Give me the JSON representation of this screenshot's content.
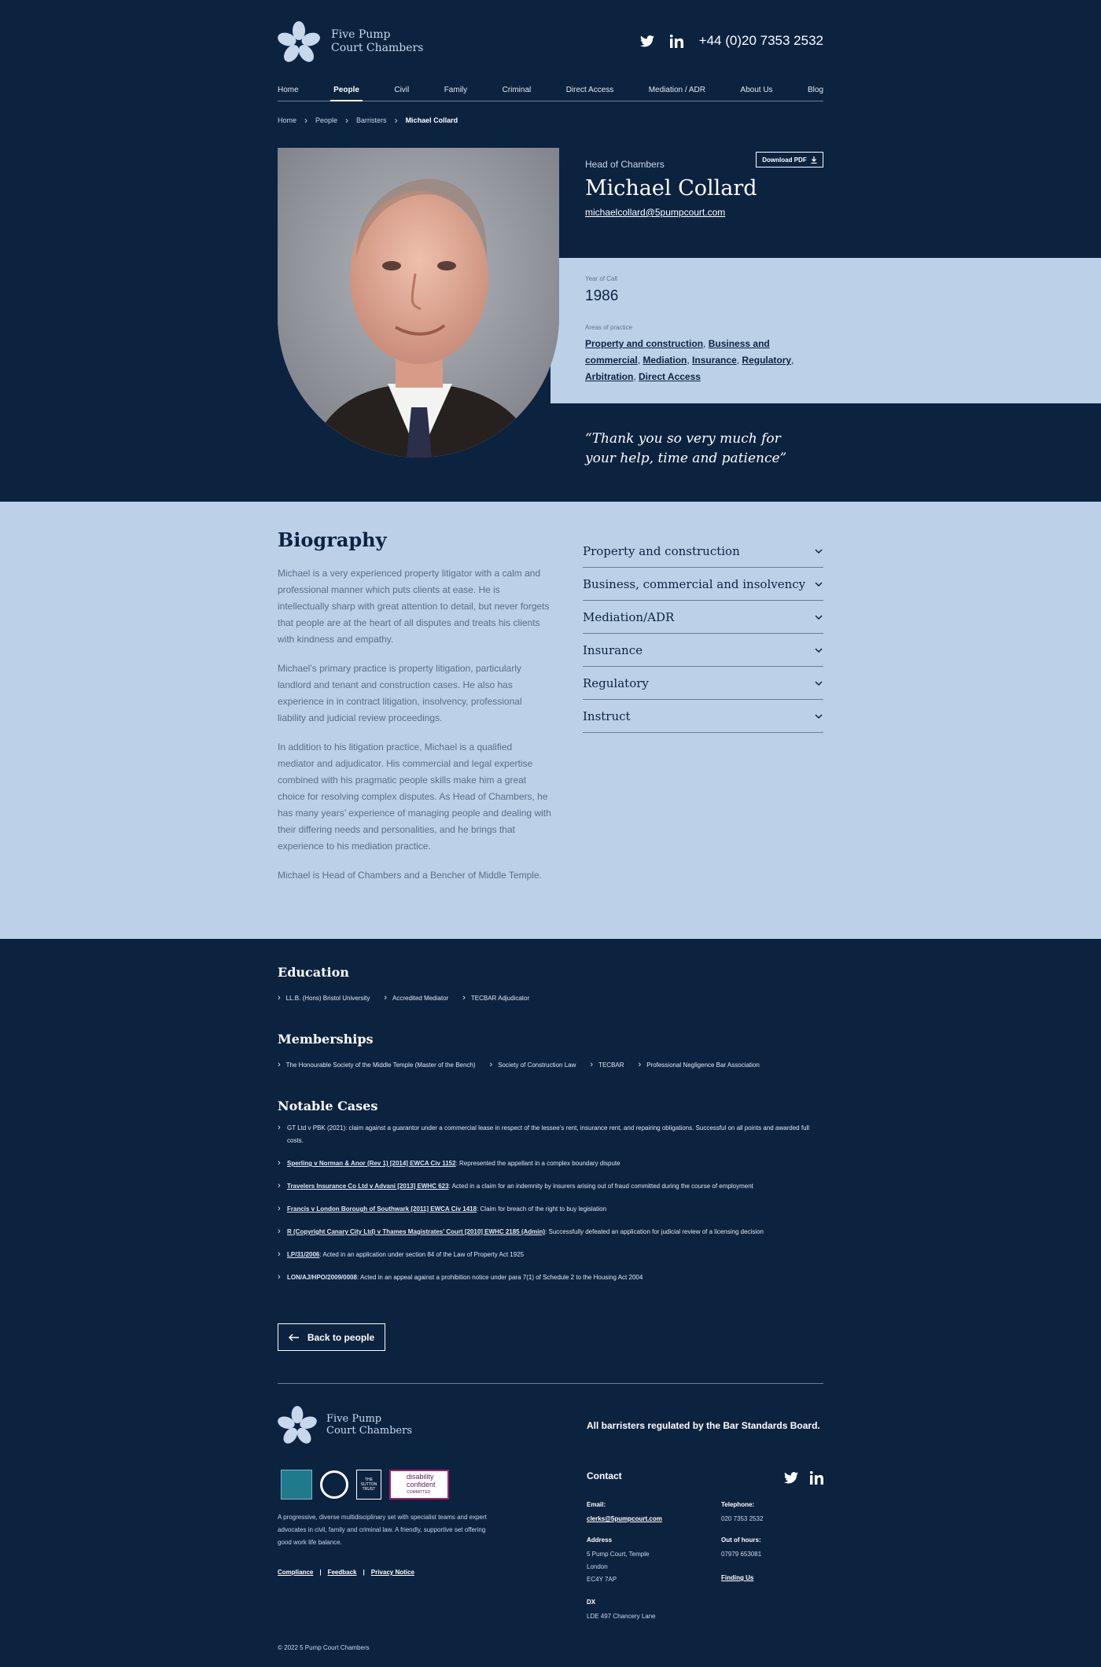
{
  "header": {
    "logo_line1": "Five Pump",
    "logo_line2": "Court Chambers",
    "phone": "+44 (0)20 7353 2532"
  },
  "nav": [
    "Home",
    "People",
    "Civil",
    "Family",
    "Criminal",
    "Direct Access",
    "Mediation / ADR",
    "About Us",
    "Blog"
  ],
  "breadcrumb": [
    "Home",
    "People",
    "Barristers",
    "Michael Collard"
  ],
  "profile": {
    "role": "Head of Chambers",
    "name": "Michael Collard",
    "email": "michaelcollard@5pumpcourt.com",
    "download_label": "Download PDF",
    "year_of_call_label": "Year of Call",
    "year_of_call": "1986",
    "areas_label": "Areas of practice",
    "areas": [
      "Property and construction",
      "Business and commercial",
      "Mediation",
      "Insurance",
      "Regulatory",
      "Arbitration",
      "Direct Access"
    ],
    "quote": "“Thank you so very much for your help, time and patience”"
  },
  "biography": {
    "title": "Biography",
    "paragraphs": [
      "Michael is a very experienced property litigator with a calm and professional manner which puts clients at ease. He is intellectually sharp with great attention to detail, but never forgets that people are at the heart of all disputes and treats his clients with kindness and empathy.",
      "Michael’s primary practice is property litigation, particularly landlord and tenant and construction cases. He also has experience in in contract litigation, insolvency, professional liability and judicial review proceedings.",
      "In addition to his litigation practice, Michael is a qualified mediator and adjudicator. His commercial and legal expertise combined with his pragmatic people skills make him a great choice for resolving complex disputes. As Head of Chambers, he has many years’ experience of managing people and dealing with their differing needs and personalities, and he brings that experience to his mediation practice.",
      "Michael is Head of Chambers and a Bencher of Middle Temple."
    ]
  },
  "accordion": [
    "Property and construction",
    "Business, commercial and insolvency",
    "Mediation/ADR",
    "Insurance",
    "Regulatory",
    "Instruct"
  ],
  "education": {
    "title": "Education",
    "items": [
      "LL.B. (Hons) Bristol University",
      "Accredited Mediator",
      "TECBAR Adjudicator"
    ]
  },
  "memberships": {
    "title": "Memberships",
    "items": [
      "The Honourable Society of the Middle Temple (Master of the Bench)",
      "Society of Construction Law",
      "TECBAR",
      "Professional Negligence Bar Association"
    ]
  },
  "cases": {
    "title": "Notable Cases",
    "items": [
      {
        "ref": "",
        "text": "GT Ltd v PBK (2021): claim against a guarantor under a commercial lease in respect of the lessee’s rent, insurance rent, and repairing obligations. Successful on all points and awarded full costs."
      },
      {
        "ref": "Sperling v Norman & Anor (Rev 1) [2014] EWCA Civ 1152",
        "text": ": Represented the appellant in a complex boundary dispute"
      },
      {
        "ref": "Travelers Insurance Co Ltd v Advani [2013] EWHC 623",
        "text": ": Acted in a claim for an indemnity by insurers arising out of fraud committed during the course of employment"
      },
      {
        "ref": "Francis v London Borough of Southwark [2011] EWCA Civ 1418",
        "text": ": Claim for breach of the right to buy legislation"
      },
      {
        "ref": "R (Copyright Canary City Ltd) v Thames Magistrates’ Court [2010] EWHC 2185 (Admin)",
        "text": ": Successfully defeated an application for judicial review of a licensing decision"
      },
      {
        "ref": "LP/31/2006",
        "text": ": Acted in an application under section 84 of the Law of Property Act 1925"
      },
      {
        "ref": "LON/AJ/HPO/2009/0008",
        "text": ": Acted in an appeal against a prohibition notice under para 7(1) of Schedule 2 to the Housing Act 2004"
      }
    ]
  },
  "back_label": "Back to people",
  "footer": {
    "regulated": "All barristers regulated by the Bar Standards Board.",
    "badge_sutton": "THE SUTTON TRUST",
    "badge_disability_1": "disability",
    "badge_disability_2": "confident",
    "badge_disability_3": "COMMITTED",
    "description": "A progressive, diverse multidisciplinary set with specialist teams and expert advocates in civil, family and criminal law. A friendly, supportive set offering good work life balance.",
    "links": [
      "Compliance",
      "Feedback",
      "Privacy Notice"
    ],
    "contact_title": "Contact",
    "email_label": "Email:",
    "email": "clerks@5pumpcourt.com",
    "telephone_label": "Telephone:",
    "telephone": "020 7353 2532",
    "address_label": "Address",
    "address": [
      "5 Pump Court, Temple",
      "London",
      "EC4Y 7AP"
    ],
    "out_of_hours_label": "Out of hours:",
    "out_of_hours": "07979 653081",
    "finding_us": "Finding Us",
    "dx_label": "DX",
    "dx": "LDE 497 Chancery Lane",
    "copyright": "© 2022 5 Pump Court Chambers"
  },
  "colors": {
    "navy": "#0c2340",
    "light_blue": "#bcd1e8"
  }
}
